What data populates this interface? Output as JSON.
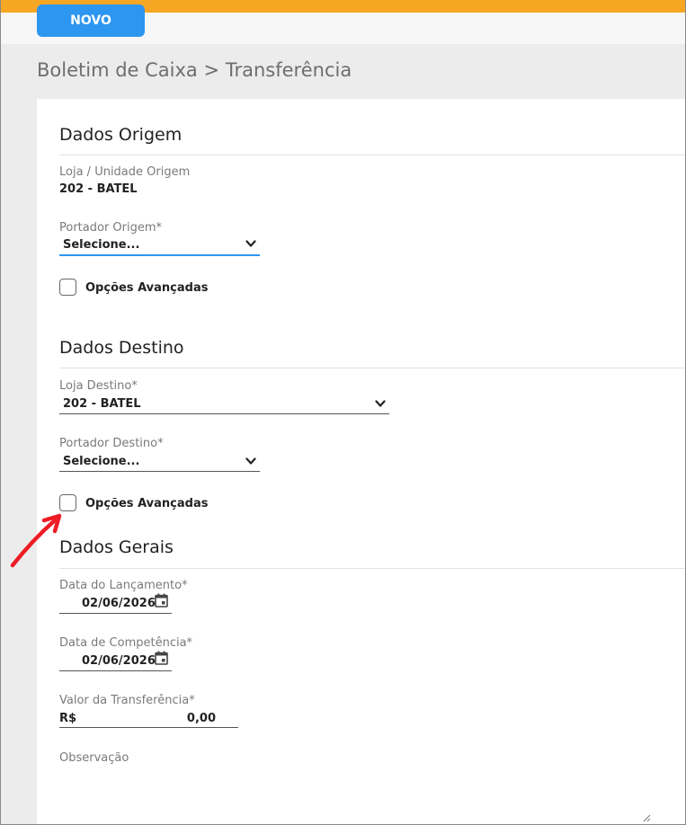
{
  "toolbar": {
    "new_label": "NOVO"
  },
  "page": {
    "title": "Boletim de Caixa > Transferência"
  },
  "origem": {
    "title": "Dados Origem",
    "loja_label": "Loja / Unidade Origem",
    "loja_value": "202 - BATEL",
    "portador_label": "Portador Origem*",
    "portador_value": "Selecione...",
    "opcoes_label": "Opções Avançadas",
    "opcoes_checked": false
  },
  "destino": {
    "title": "Dados Destino",
    "loja_label": "Loja Destino*",
    "loja_value": "202 - BATEL",
    "portador_label": "Portador Destino*",
    "portador_value": "Selecione...",
    "opcoes_label": "Opções Avançadas",
    "opcoes_checked": false
  },
  "gerais": {
    "title": "Dados Gerais",
    "data_lancamento_label": "Data do Lançamento*",
    "data_lancamento_value": "02/06/2026",
    "data_competencia_label": "Data de Competência*",
    "data_competencia_value": "02/06/2026",
    "valor_label": "Valor da Transferência*",
    "valor_currency": "R$",
    "valor_amount": "0,00",
    "observacao_label": "Observação",
    "observacao_value": ""
  },
  "colors": {
    "top_bar": "#f5a623",
    "button": "#2d96f0",
    "focus": "#2d96f0",
    "annotation_arrow": "#ee1c25"
  },
  "icons": [
    "chevron-down-icon",
    "calendar-icon",
    "resize-grip-icon",
    "annotation-arrow"
  ]
}
